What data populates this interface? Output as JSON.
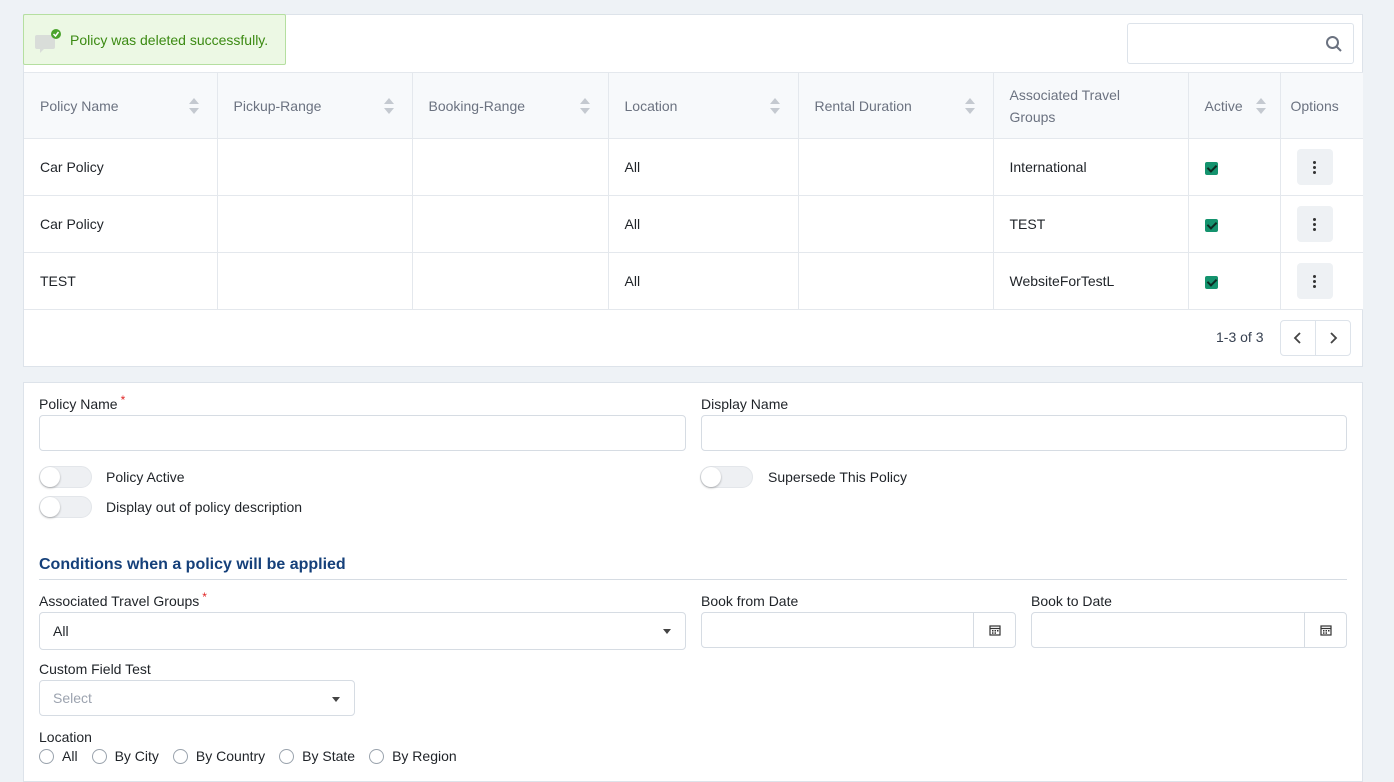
{
  "toast": {
    "message": "Policy was deleted successfully.",
    "icon": "notification-icon"
  },
  "search": {
    "placeholder": "",
    "value": ""
  },
  "table": {
    "columns": [
      "Policy Name",
      "Pickup-Range",
      "Booking-Range",
      "Location",
      "Rental Duration",
      "Associated Travel Groups",
      "Active",
      "Options"
    ],
    "rows": [
      {
        "policy_name": "Car Policy",
        "pickup_range": "",
        "booking_range": "",
        "location": "All",
        "rental_duration": "",
        "travel_groups": "International",
        "active": true
      },
      {
        "policy_name": "Car Policy",
        "pickup_range": "",
        "booking_range": "",
        "location": "All",
        "rental_duration": "",
        "travel_groups": "TEST",
        "active": true
      },
      {
        "policy_name": "TEST",
        "pickup_range": "",
        "booking_range": "",
        "location": "All",
        "rental_duration": "",
        "travel_groups": "WebsiteForTestL",
        "active": true
      }
    ]
  },
  "pagination": {
    "summary": "1-3 of 3"
  },
  "form": {
    "policy_name_label": "Policy Name",
    "required_mark": "*",
    "display_name_label": "Display Name",
    "policy_active_label": "Policy Active",
    "supersede_label": "Supersede This Policy",
    "display_out_label": "Display out of policy description",
    "section_title": "Conditions when a policy will be applied",
    "travel_groups_label": "Associated Travel Groups",
    "travel_groups_value": "All",
    "book_from_label": "Book from Date",
    "book_to_label": "Book to Date",
    "custom_field_label": "Custom Field Test",
    "custom_field_placeholder": "Select",
    "location_label": "Location",
    "location_options": [
      "All",
      "By City",
      "By Country",
      "By State",
      "By Region"
    ]
  },
  "colors": {
    "accent": "#15407a",
    "success_text": "#3b8a12",
    "success_bg": "#ecf8e4",
    "checkbox": "#14936e",
    "required": "#e02424"
  }
}
